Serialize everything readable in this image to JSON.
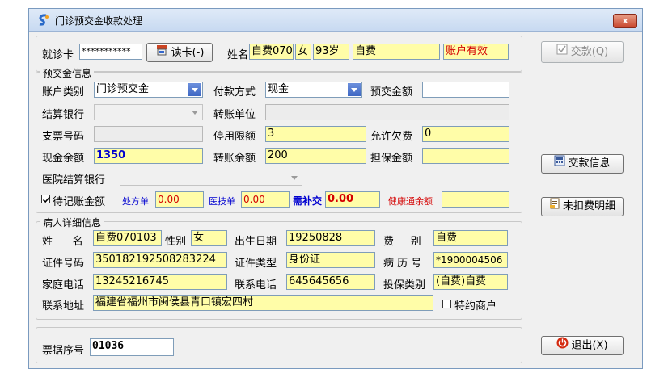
{
  "window": {
    "title": "门诊预交金收款处理",
    "close": "x"
  },
  "card": {
    "label": "就诊卡",
    "number": "***********",
    "read_button": "读卡(-)",
    "name_label": "姓名",
    "name": "自费070:",
    "gender": "女",
    "age": "93岁",
    "fee_type": "自费",
    "account_status": "账户有效"
  },
  "prepay": {
    "title": "预交金信息",
    "account_type_label": "账户类别",
    "account_type": "门诊预交金",
    "pay_method_label": "付款方式",
    "pay_method": "现金",
    "prepay_amount_label": "预交金额",
    "prepay_amount": "",
    "bank_label": "结算银行",
    "bank": "",
    "transfer_unit_label": "转账单位",
    "transfer_unit": "",
    "cheque_label": "支票号码",
    "cheque": "",
    "stop_limit_label": "停用限额",
    "stop_limit": "3",
    "allow_owe_label": "允许欠费",
    "allow_owe": "0",
    "cash_balance_label": "现金余额",
    "cash_balance": "1350",
    "transfer_balance_label": "转账余额",
    "transfer_balance": "200",
    "guarantee_label": "担保金额",
    "guarantee": "",
    "hospital_bank_label": "医院结算银行",
    "hospital_bank": "",
    "pending_label": "待记账金额",
    "rx_label": "处方单",
    "rx_value": "0.00",
    "tech_label": "医技单",
    "tech_value": "0.00",
    "supplement_label": "需补交",
    "supplement_value": "0.00",
    "health_label": "健康通余额",
    "health_value": ""
  },
  "patient": {
    "title": "病人详细信息",
    "name_label": "姓      名",
    "name": "自费070103",
    "gender_label": "性别",
    "gender": "女",
    "birth_label": "出生日期",
    "birth": "19250828",
    "fee_label": "费     别",
    "fee": "自费",
    "id_label": "证件号码",
    "id_number": "350182192508283224",
    "id_type_label": "证件类型",
    "id_type": "身份证",
    "record_label": "病 历 号",
    "record": "*1900004506",
    "home_phone_label": "家庭电话",
    "home_phone": "13245216745",
    "contact_phone_label": "联系电话",
    "contact_phone": "645645656",
    "insurance_label": "投保类别",
    "insurance": "(自费)自费",
    "address_label": "联系地址",
    "address": "福建省福州市闽侯县青口镇宏四村",
    "special_label": "特约商户"
  },
  "receipt": {
    "label": "票据序号",
    "number": "01036"
  },
  "side": {
    "pay_button": "交款(Q)",
    "pay_info_button": "交款信息",
    "unpaid_button": "未扣费明细",
    "exit_button": "退出(X)"
  }
}
